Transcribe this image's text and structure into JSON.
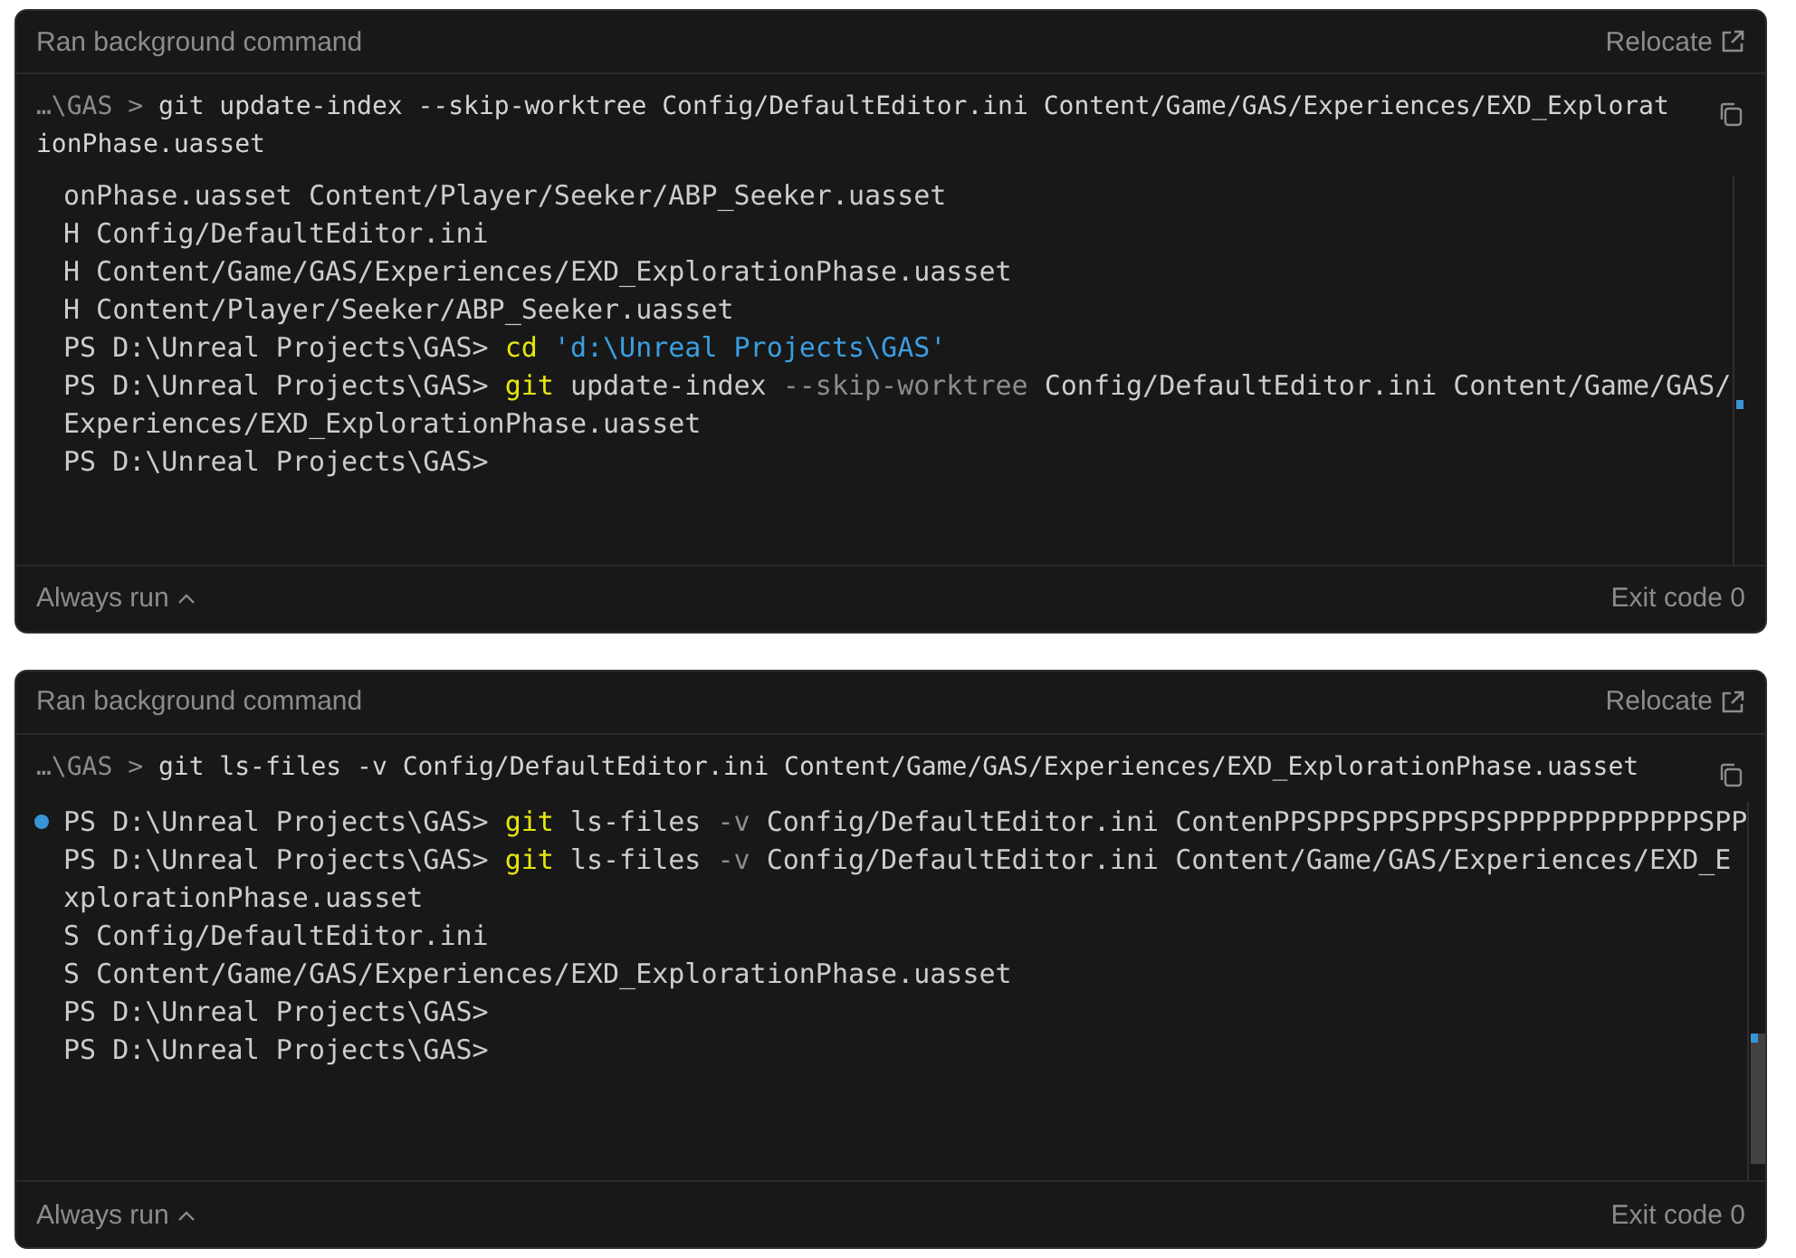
{
  "panels": [
    {
      "title": "Ran background command",
      "relocate": "Relocate",
      "command_prompt": "…\\GAS",
      "command_separator": ">",
      "command_lines": [
        "git update-index --skip-worktree Config/DefaultEditor.ini Content/Game/GAS/Experiences/EXD_Explorat",
        "ionPhase.uasset"
      ],
      "output": [
        {
          "marked": false,
          "segments": [
            {
              "kind": "plain",
              "text": "onPhase.uasset Content/Player/Seeker/ABP_Seeker.uasset"
            }
          ]
        },
        {
          "marked": false,
          "segments": [
            {
              "kind": "plain",
              "text": "H Config/DefaultEditor.ini"
            }
          ]
        },
        {
          "marked": false,
          "segments": [
            {
              "kind": "plain",
              "text": "H Content/Game/GAS/Experiences/EXD_ExplorationPhase.uasset"
            }
          ]
        },
        {
          "marked": false,
          "segments": [
            {
              "kind": "plain",
              "text": "H Content/Player/Seeker/ABP_Seeker.uasset"
            }
          ]
        },
        {
          "marked": false,
          "segments": [
            {
              "kind": "plain",
              "text": "PS D:\\Unreal Projects\\GAS> "
            },
            {
              "kind": "cmd",
              "text": "cd"
            },
            {
              "kind": "string",
              "text": " 'd:\\Unreal Projects\\GAS'"
            }
          ]
        },
        {
          "marked": false,
          "segments": [
            {
              "kind": "plain",
              "text": "PS D:\\Unreal Projects\\GAS> "
            },
            {
              "kind": "cmd",
              "text": "git"
            },
            {
              "kind": "plain",
              "text": " update-index "
            },
            {
              "kind": "flag",
              "text": "--skip-worktree"
            },
            {
              "kind": "plain",
              "text": " Config/DefaultEditor.ini Content/Game/GAS/"
            }
          ]
        },
        {
          "marked": false,
          "segments": [
            {
              "kind": "plain",
              "text": "Experiences/EXD_ExplorationPhase.uasset"
            }
          ]
        },
        {
          "marked": false,
          "segments": [
            {
              "kind": "plain",
              "text": "PS D:\\Unreal Projects\\GAS>"
            }
          ]
        }
      ],
      "footer_left": "Always run",
      "exit": "Exit code 0"
    },
    {
      "title": "Ran background command",
      "relocate": "Relocate",
      "command_prompt": "…\\GAS",
      "command_separator": ">",
      "command_lines": [
        "git ls-files -v Config/DefaultEditor.ini Content/Game/GAS/Experiences/EXD_ExplorationPhase.uasset"
      ],
      "output": [
        {
          "marked": true,
          "segments": [
            {
              "kind": "plain",
              "text": "PS D:\\Unreal Projects\\GAS> "
            },
            {
              "kind": "cmd",
              "text": "git"
            },
            {
              "kind": "plain",
              "text": " ls-files "
            },
            {
              "kind": "flag",
              "text": "-v"
            },
            {
              "kind": "plain",
              "text": " Config/DefaultEditor.ini ContenPPSPPSPPSPPSPSPPPPPPPPPPPPSPP"
            }
          ]
        },
        {
          "marked": false,
          "segments": [
            {
              "kind": "plain",
              "text": "PS D:\\Unreal Projects\\GAS> "
            },
            {
              "kind": "cmd",
              "text": "git"
            },
            {
              "kind": "plain",
              "text": " ls-files "
            },
            {
              "kind": "flag",
              "text": "-v"
            },
            {
              "kind": "plain",
              "text": " Config/DefaultEditor.ini Content/Game/GAS/Experiences/EXD_E"
            }
          ]
        },
        {
          "marked": false,
          "segments": [
            {
              "kind": "plain",
              "text": "xplorationPhase.uasset"
            }
          ]
        },
        {
          "marked": false,
          "segments": [
            {
              "kind": "plain",
              "text": "S Config/DefaultEditor.ini"
            }
          ]
        },
        {
          "marked": false,
          "segments": [
            {
              "kind": "plain",
              "text": "S Content/Game/GAS/Experiences/EXD_ExplorationPhase.uasset"
            }
          ]
        },
        {
          "marked": false,
          "segments": [
            {
              "kind": "plain",
              "text": "PS D:\\Unreal Projects\\GAS>"
            }
          ]
        },
        {
          "marked": false,
          "segments": [
            {
              "kind": "plain",
              "text": "PS D:\\Unreal Projects\\GAS>"
            }
          ]
        }
      ],
      "footer_left": "Always run",
      "exit": "Exit code 0"
    }
  ]
}
